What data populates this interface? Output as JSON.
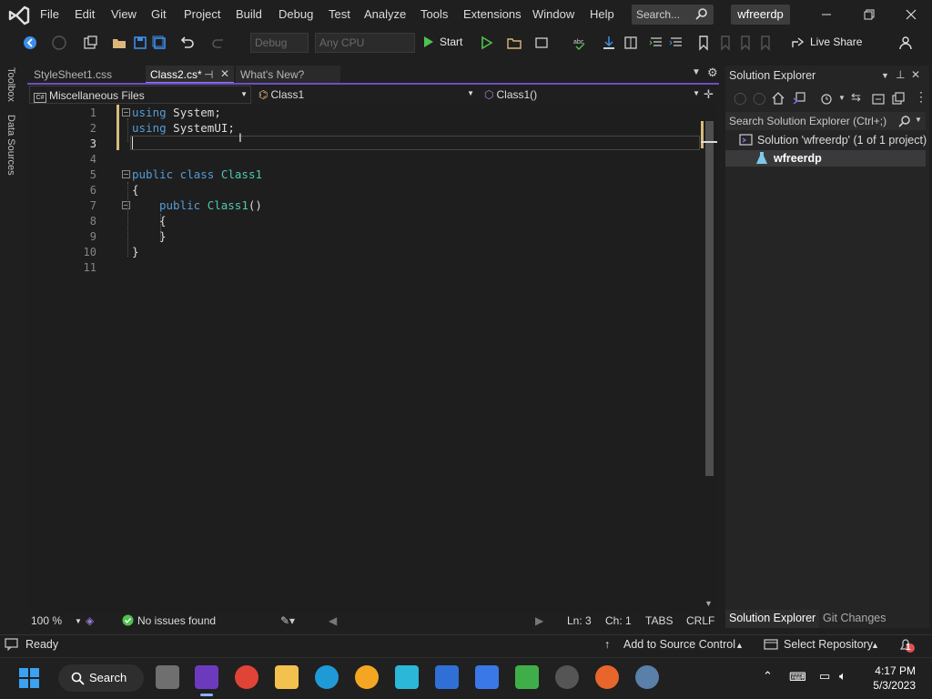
{
  "menu": [
    "File",
    "Edit",
    "View",
    "Git",
    "Project",
    "Build",
    "Debug",
    "Test",
    "Analyze",
    "Tools",
    "Extensions",
    "Window",
    "Help"
  ],
  "search": {
    "placeholder": "Search..."
  },
  "project_badge": "wfreerdp",
  "toolbar": {
    "config": "Debug",
    "platform": "Any CPU",
    "start": "Start",
    "live_share": "Live Share"
  },
  "left_rail": {
    "toolbox": "Toolbox",
    "data_sources": "Data Sources"
  },
  "doc_tabs": [
    {
      "label": "StyleSheet1.css"
    },
    {
      "label": "Class2.cs*"
    },
    {
      "label": "What's New?"
    }
  ],
  "nav_bar": {
    "project": "Miscellaneous Files",
    "type": "Class1",
    "member": "Class1()"
  },
  "editor": {
    "line_numbers": [
      "1",
      "2",
      "3",
      "4",
      "5",
      "6",
      "7",
      "8",
      "9",
      "10",
      "11"
    ],
    "lines": [
      {
        "kw": "using",
        "text": " System;"
      },
      {
        "kw": "using",
        "text": " SystemUI;"
      },
      {
        "kw": "",
        "text": ""
      },
      {
        "kw": "",
        "text": ""
      },
      {
        "kw": "public class",
        "cls": "Class1"
      },
      {
        "text": "{"
      },
      {
        "kw": "public",
        "cls": "Class1",
        "text": "()"
      },
      {
        "text": "{"
      },
      {
        "text": "}"
      },
      {
        "text": "}"
      },
      {
        "text": ""
      }
    ]
  },
  "editor_status": {
    "zoom": "100 %",
    "issues": "No issues found",
    "line": "Ln: 3",
    "col": "Ch: 1",
    "tabs": "TABS",
    "eol": "CRLF"
  },
  "solution_explorer": {
    "title": "Solution Explorer",
    "search_placeholder": "Search Solution Explorer (Ctrl+;)",
    "solution": "Solution 'wfreerdp' (1 of 1 project)",
    "project": "wfreerdp",
    "tabs": [
      "Solution Explorer",
      "Git Changes"
    ]
  },
  "status": {
    "ready": "Ready",
    "source_control": "Add to Source Control",
    "repository": "Select Repository",
    "notifications": "1"
  },
  "taskbar": {
    "search": "Search",
    "time": "4:17 PM",
    "date": "5/3/2023"
  },
  "colors": {
    "accent": "#9b6ef3",
    "keyword": "#569cd6",
    "type": "#4ec9b0",
    "change_bar": "#d7ba7d"
  }
}
